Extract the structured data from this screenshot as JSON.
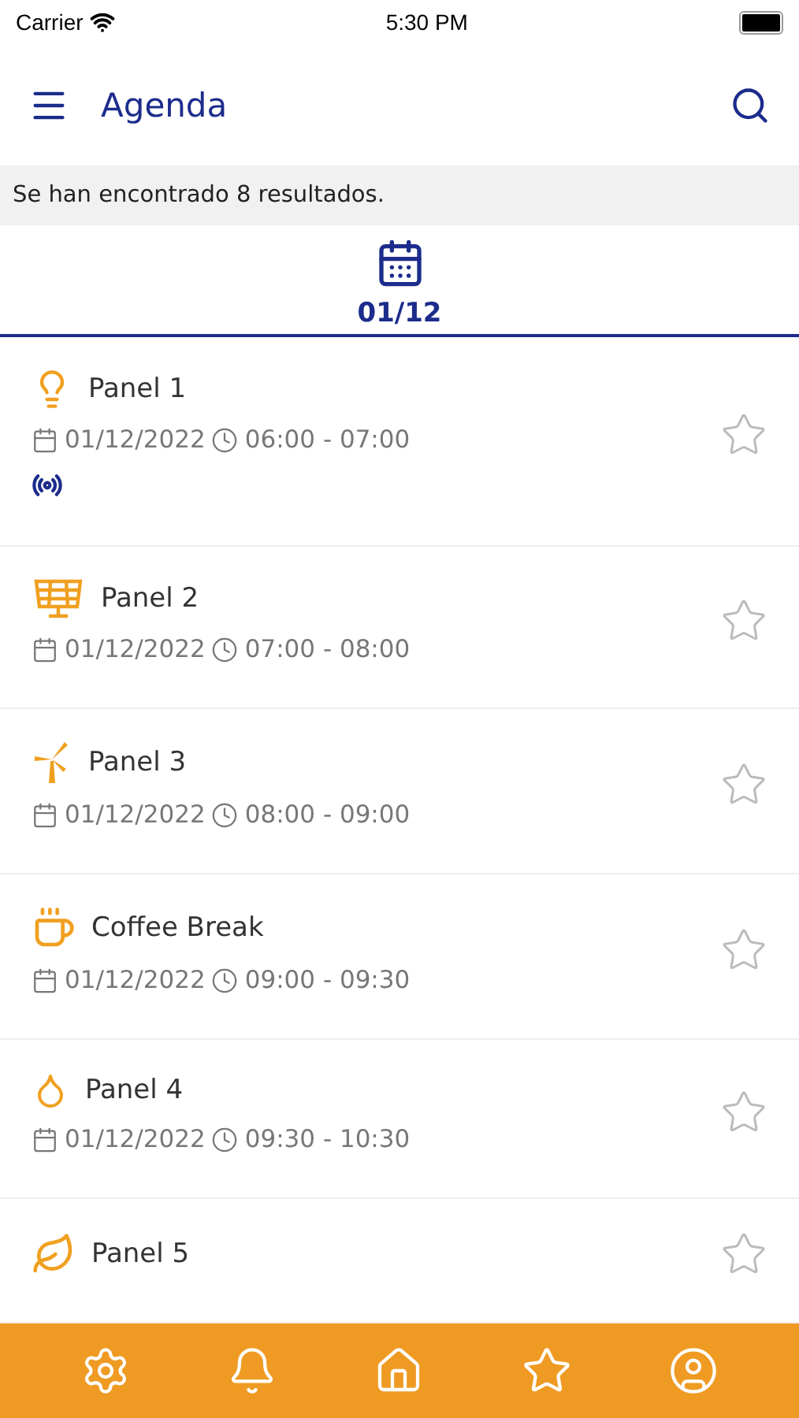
{
  "status_bar": {
    "carrier": "Carrier",
    "time": "5:30 PM"
  },
  "header": {
    "title": "Agenda"
  },
  "results": "Se han encontrado 8 resultados.",
  "date_tabs": [
    {
      "label": "01/12",
      "selected": true
    }
  ],
  "events": [
    {
      "kind": "bulb",
      "title": "Panel 1",
      "date": "01/12/2022",
      "time": "06:00 - 07:00",
      "live": true,
      "favorite": false
    },
    {
      "kind": "solar",
      "title": "Panel 2",
      "date": "01/12/2022",
      "time": "07:00 - 08:00",
      "live": false,
      "favorite": false
    },
    {
      "kind": "wind",
      "title": "Panel 3",
      "date": "01/12/2022",
      "time": "08:00 - 09:00",
      "live": false,
      "favorite": false
    },
    {
      "kind": "coffee",
      "title": "Coffee Break",
      "date": "01/12/2022",
      "time": "09:00 - 09:30",
      "live": false,
      "favorite": false
    },
    {
      "kind": "drop",
      "title": "Panel 4",
      "date": "01/12/2022",
      "time": "09:30 - 10:30",
      "live": false,
      "favorite": false
    },
    {
      "kind": "leaf",
      "title": "Panel 5",
      "live": false,
      "favorite": false
    }
  ],
  "tab_bar": [
    {
      "kind": "settings"
    },
    {
      "kind": "bell"
    },
    {
      "kind": "home"
    },
    {
      "kind": "star"
    },
    {
      "kind": "profile"
    }
  ]
}
